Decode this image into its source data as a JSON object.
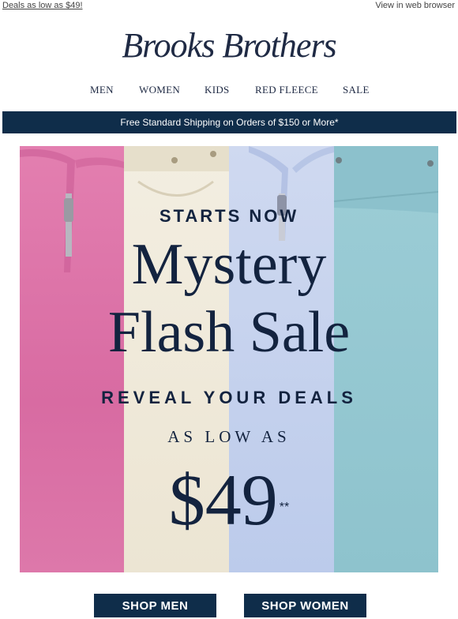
{
  "topbar": {
    "preheader": "Deals as low as $49!",
    "view_in_browser": "View in web browser"
  },
  "brand": {
    "logo_text": "Brooks Brothers"
  },
  "nav": {
    "items": [
      {
        "label": "MEN"
      },
      {
        "label": "WOMEN"
      },
      {
        "label": "KIDS"
      },
      {
        "label": "RED FLEECE"
      },
      {
        "label": "SALE"
      }
    ]
  },
  "shipping_banner": {
    "text": "Free Standard Shipping on Orders of $150 or More*"
  },
  "hero": {
    "eyebrow": "STARTS NOW",
    "headline_line1": "Mystery",
    "headline_line2": "Flash Sale",
    "subhead": "REVEAL YOUR DEALS",
    "as_low_as": "AS LOW AS",
    "price": "$49",
    "price_footnote": "**",
    "stripe_colors": [
      "#dd78aa",
      "#efe9da",
      "#c6d2ed",
      "#95c8d1"
    ]
  },
  "cta": {
    "men": "SHOP MEN",
    "women": "SHOP WOMEN"
  },
  "colors": {
    "navy": "#0f2d4a",
    "text_navy": "#13233f"
  }
}
